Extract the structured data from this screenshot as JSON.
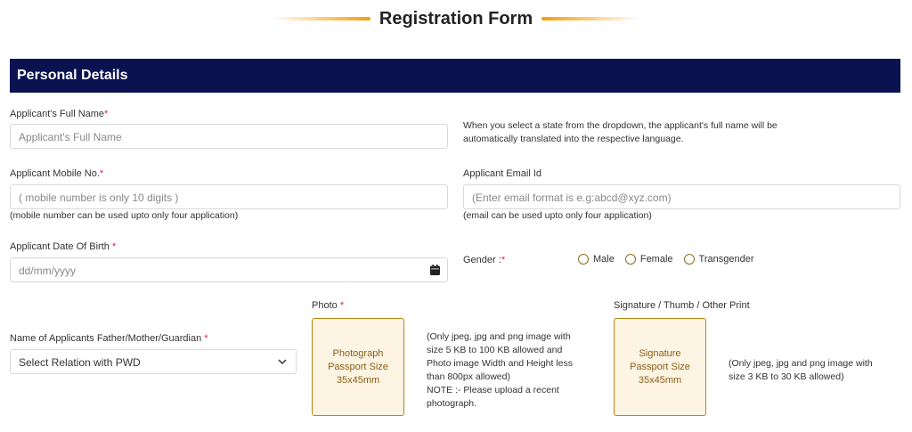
{
  "page": {
    "title": "Registration Form"
  },
  "section": {
    "title": "Personal Details"
  },
  "fields": {
    "full_name": {
      "label": "Applicant's Full Name",
      "required": "*",
      "placeholder": "Applicant's Full Name"
    },
    "translate_note_line1": "When you select a state from the dropdown, the applicant's full name will be",
    "translate_note_line2": "automatically translated into the respective language.",
    "mobile": {
      "label": "Applicant Mobile No.",
      "required": "*",
      "placeholder": "( mobile number is only 10 digits )",
      "hint": "(mobile number can be used upto only four application)"
    },
    "email": {
      "label": "Applicant Email Id",
      "placeholder": "(Enter email format is e.g:abcd@xyz.com)",
      "hint": "(email can be used upto only four application)"
    },
    "dob": {
      "label": "Applicant Date Of Birth ",
      "required": "*",
      "placeholder": "dd/mm/yyyy"
    },
    "gender": {
      "label": "Gender :",
      "required": "*",
      "options": [
        "Male",
        "Female",
        "Transgender"
      ]
    },
    "guardian": {
      "label": "Name of Applicants Father/Mother/Guardian ",
      "required": "*",
      "selected": "Select Relation with PWD"
    },
    "photo": {
      "label": "Photo ",
      "required": "*",
      "box_lines": [
        "Photograph",
        "Passport Size",
        "35x45mm"
      ],
      "note_lines": [
        "(Only jpeg, jpg and png image with",
        "size 5 KB to 100 KB allowed and",
        "Photo image Width and Height less",
        "than 800px allowed)",
        "NOTE :- Please upload a recent",
        "photograph."
      ]
    },
    "signature": {
      "label": "Signature / Thumb / Other Print",
      "box_lines": [
        "Signature",
        "Passport Size",
        "35x45mm"
      ],
      "note_lines": [
        "(Only jpeg, jpg and png image with",
        "size 3 KB to 30 KB allowed)"
      ]
    }
  },
  "colors": {
    "header_bg": "#0a1250",
    "accent": "#f59e0b",
    "required": "#e11d48",
    "upload_bg": "#fdf4e4",
    "upload_border": "#b7860b"
  },
  "icons": {
    "date": "calendar-icon",
    "select": "chevron-down-icon"
  }
}
